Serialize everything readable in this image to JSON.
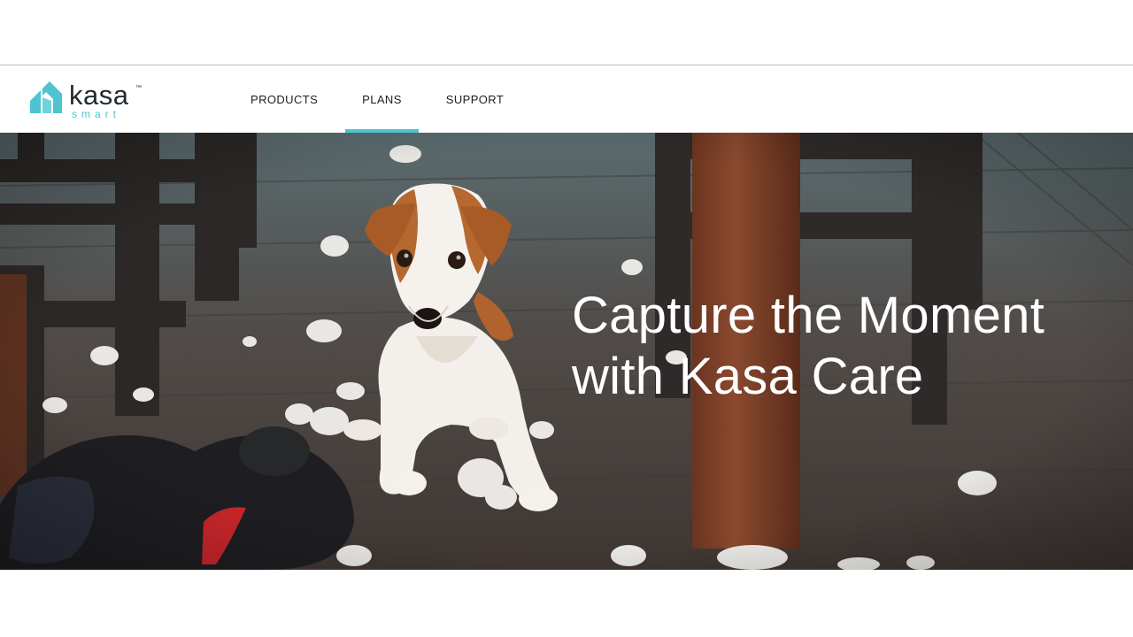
{
  "logo": {
    "word": "kasa",
    "trademark": "™",
    "sub": "smart",
    "icon": "kasa-house-icon"
  },
  "nav": {
    "items": [
      {
        "label": "PRODUCTS",
        "active": false
      },
      {
        "label": "PLANS",
        "active": true
      },
      {
        "label": "SUPPORT",
        "active": false
      }
    ]
  },
  "hero": {
    "title_line1": "Capture the Moment",
    "title_line2": "with Kasa Care",
    "image": "puppy-with-torn-toy-photo"
  },
  "colors": {
    "accent": "#4dc4cf",
    "text": "#1e1e1e"
  }
}
